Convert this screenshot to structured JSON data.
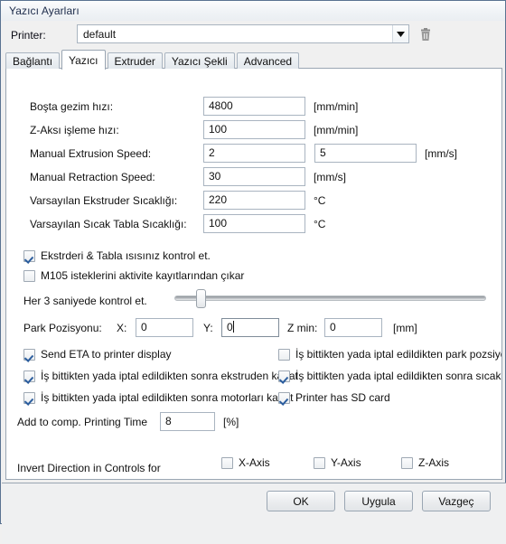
{
  "window": {
    "title": "Yazıcı Ayarları"
  },
  "printer": {
    "label": "Printer:",
    "value": "default",
    "dropdown_icon": "chevron-down-icon",
    "delete_icon": "trash-icon"
  },
  "tabs": [
    {
      "label": "Bağlantı",
      "active": false
    },
    {
      "label": "Yazıcı",
      "active": true
    },
    {
      "label": "Extruder",
      "active": false
    },
    {
      "label": "Yazıcı Şekli",
      "active": false
    },
    {
      "label": "Advanced",
      "active": false
    }
  ],
  "fields": [
    {
      "label": "Boşta gezim hızı:",
      "value": "4800",
      "unit": "[mm/min]"
    },
    {
      "label": "Z-Aksı işleme hızı:",
      "value": "100",
      "unit": "[mm/min]"
    },
    {
      "label": "Manual Extrusion Speed:",
      "value": "2",
      "value2": "5",
      "unit": "[mm/s]"
    },
    {
      "label": "Manual Retraction Speed:",
      "value": "30",
      "unit": "[mm/s]"
    },
    {
      "label": "Varsayılan Ekstruder Sıcaklığı:",
      "value": "220",
      "unit": "°C"
    },
    {
      "label": "Varsayılan Sıcak Tabla Sıcaklığı:",
      "value": "100",
      "unit": "°C"
    }
  ],
  "monitor": {
    "check_temps": {
      "label": "Ekstrderi & Tabla ısısınız kontrol et.",
      "checked": true
    },
    "remove_m105": {
      "label": "M105 isteklerini aktivite kayıtlarından çıkar",
      "checked": false
    },
    "interval_label": "Her 3 saniyede kontrol et.",
    "interval_value": 3
  },
  "park": {
    "label": "Park Pozisyonu:",
    "x_label": "X:",
    "x_value": "0",
    "y_label": "Y:",
    "y_value": "0",
    "z_label": "Z min:",
    "z_value": "0",
    "unit": "[mm]"
  },
  "options_left": [
    {
      "label": "Send ETA to printer display",
      "checked": true
    },
    {
      "label": "İş bittikten yada iptal edildikten sonra ekstruden kapat",
      "checked": true
    },
    {
      "label": "İş bittikten yada iptal edildikten sonra motorları kapat",
      "checked": true
    }
  ],
  "options_right": [
    {
      "label": "İş bittikten yada iptal edildikten park pozsiyonuna",
      "checked": false
    },
    {
      "label": "İş bittikten yada iptal edildikten sonra sıcak tablay",
      "checked": true
    },
    {
      "label": "Printer has SD card",
      "checked": true
    }
  ],
  "print_time": {
    "label": "Add to comp. Printing Time",
    "value": "8",
    "unit": "[%]"
  },
  "invert": {
    "label": "Invert Direction in Controls for",
    "axes": [
      {
        "label": "X-Axis",
        "checked": false
      },
      {
        "label": "Y-Axis",
        "checked": false
      },
      {
        "label": "Z-Axis",
        "checked": false
      }
    ]
  },
  "buttons": {
    "ok": "OK",
    "apply": "Uygula",
    "cancel": "Vazgeç"
  }
}
